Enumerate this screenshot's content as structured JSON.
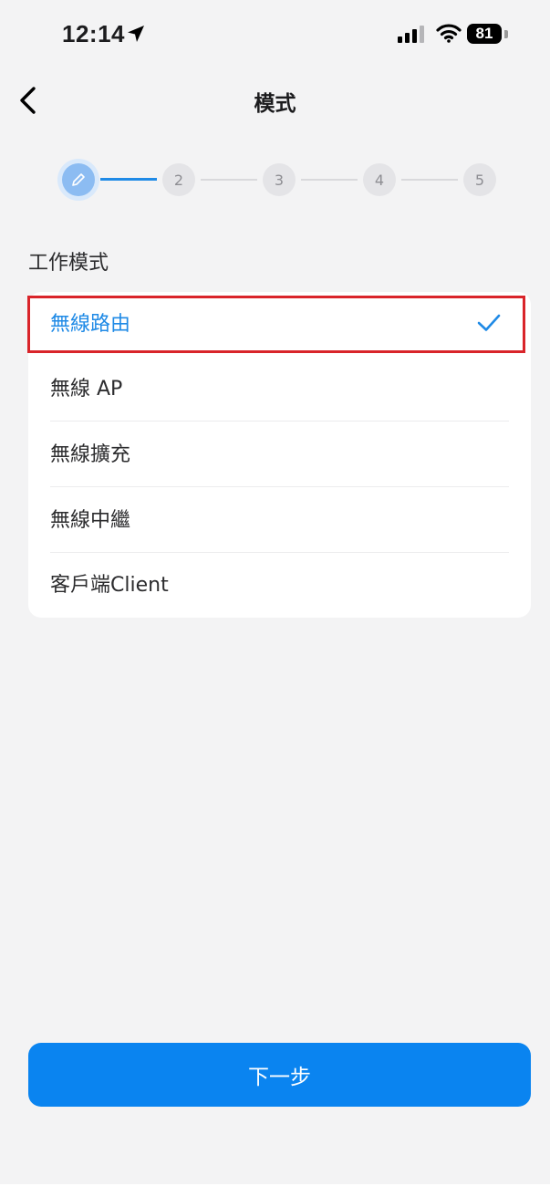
{
  "status_bar": {
    "time": "12:14",
    "battery": "81"
  },
  "nav": {
    "title": "模式"
  },
  "stepper": {
    "steps": [
      "2",
      "3",
      "4",
      "5"
    ],
    "current_step": 1
  },
  "section": {
    "title": "工作模式"
  },
  "modes": [
    {
      "label": "無線路由",
      "selected": true
    },
    {
      "label": "無線 AP",
      "selected": false
    },
    {
      "label": "無線擴充",
      "selected": false
    },
    {
      "label": "無線中繼",
      "selected": false
    },
    {
      "label": "客戶端Client",
      "selected": false
    }
  ],
  "footer": {
    "next_label": "下一步"
  },
  "colors": {
    "accent": "#1f8ae6",
    "button": "#0a84f0",
    "highlight": "#d9242a",
    "background": "#f3f3f4"
  }
}
